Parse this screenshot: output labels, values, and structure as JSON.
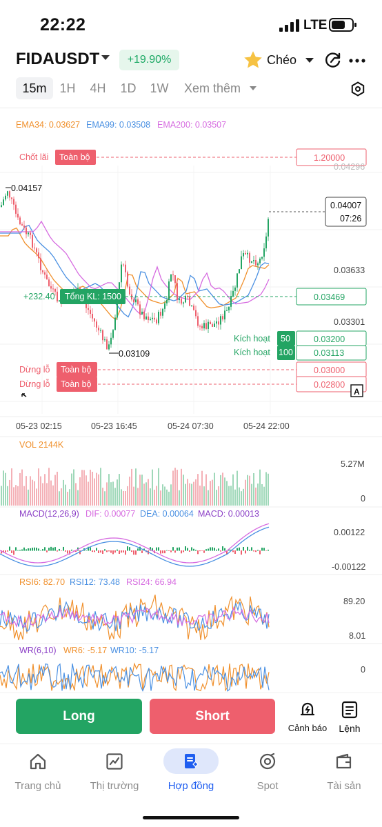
{
  "status_bar": {
    "time": "22:22",
    "network": "LTE"
  },
  "header": {
    "symbol": "FIDAUSDT",
    "change": "+19.90%",
    "margin_mode": "Chéo",
    "icons": [
      "chevron-down-icon",
      "star-icon",
      "refresh-icon",
      "more-icon"
    ]
  },
  "timeframes": {
    "items": [
      "15m",
      "1H",
      "4H",
      "1D",
      "1W"
    ],
    "active": "15m",
    "more": "Xem thêm"
  },
  "chart": {
    "ema": {
      "ema34": "EMA34: 0.03627",
      "ema99": "EMA99: 0.03508",
      "ema200": "EMA200: 0.03507"
    },
    "take_profit": {
      "label": "Chốt lãi",
      "tag": "Toàn bộ",
      "price": "1.20000"
    },
    "clipped_tick": "0.04296",
    "high_label": "0.04157",
    "low_label": "0.03109",
    "last_price": {
      "price": "0.04007",
      "countdown": "07:26"
    },
    "price_ticks": [
      "0.03633",
      "0.03301"
    ],
    "position": {
      "pnl": "+232.40",
      "size": "Tổng KL: 1500",
      "entry": "0.03469"
    },
    "triggers": [
      {
        "label": "Kích hoạt",
        "qty": "50",
        "price": "0.03200"
      },
      {
        "label": "Kích hoạt",
        "qty": "100",
        "price": "0.03113"
      }
    ],
    "stop_losses": [
      {
        "label": "Dừng lỗ",
        "tag": "Toàn bộ",
        "price": "0.03000"
      },
      {
        "label": "Dừng lỗ",
        "tag": "Toàn bộ",
        "price": "0.02800"
      }
    ],
    "auto_scale": "A",
    "time_labels": [
      "05-23 02:15",
      "05-23 16:45",
      "05-24 07:30",
      "05-24 22:00"
    ],
    "volume": {
      "label": "VOL 2144K",
      "max": "5.27M",
      "min": "0"
    },
    "macd": {
      "params": "MACD(12,26,9)",
      "dif": "DIF: 0.00077",
      "dea": "DEA: 0.00064",
      "macd": "MACD: 0.00013",
      "top": "0.00122",
      "bottom": "-0.00122"
    },
    "rsi": {
      "rsi6": "RSI6: 82.70",
      "rsi12": "RSI12: 73.48",
      "rsi24": "RSI24: 66.94",
      "top": "89.20",
      "bottom": "8.01"
    },
    "wr": {
      "params": "WR(6,10)",
      "wr6": "WR6: -5.17",
      "wr10": "WR10: -5.17",
      "top": "0"
    },
    "colors": {
      "up": "#23a463",
      "down": "#ee5f6d",
      "ema34": "#f0902c",
      "ema99": "#4a90e2",
      "ema200": "#d66be0"
    }
  },
  "actions": {
    "long": "Long",
    "short": "Short",
    "alert": "Cảnh báo",
    "orders": "Lệnh"
  },
  "nav": {
    "items": [
      {
        "label": "Trang chủ",
        "icon": "home-icon"
      },
      {
        "label": "Thị trường",
        "icon": "market-chart-icon"
      },
      {
        "label": "Hợp đồng",
        "icon": "contract-icon"
      },
      {
        "label": "Spot",
        "icon": "spot-icon"
      },
      {
        "label": "Tài sản",
        "icon": "wallet-icon"
      }
    ],
    "active": "Hợp đồng"
  }
}
